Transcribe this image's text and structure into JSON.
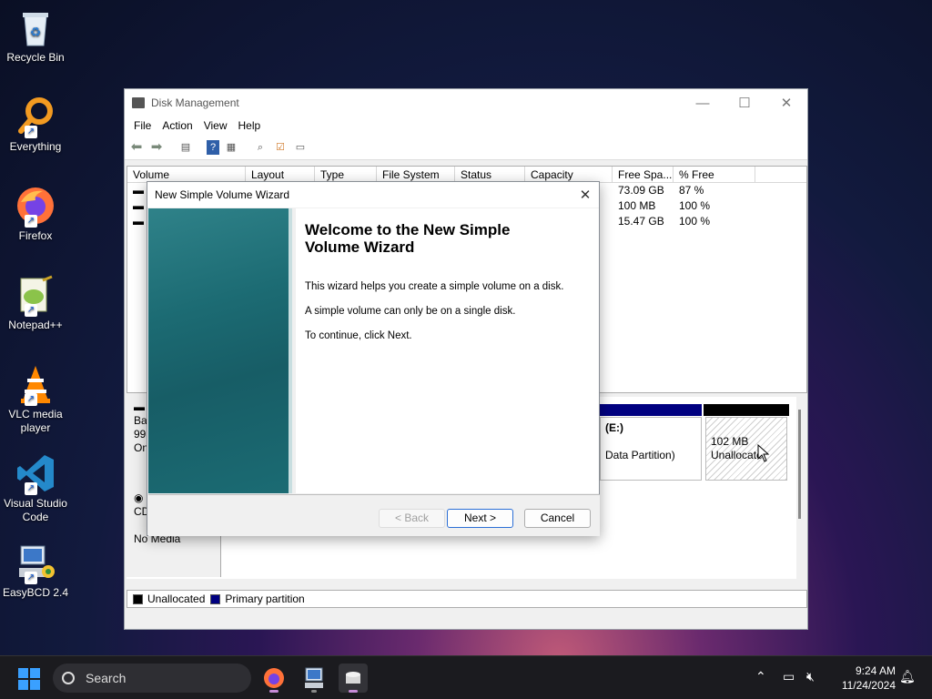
{
  "desktop": {
    "icons": [
      {
        "label": "Recycle Bin",
        "icon": "recycle-bin-icon"
      },
      {
        "label": "Everything",
        "icon": "everything-search-icon"
      },
      {
        "label": "Firefox",
        "icon": "firefox-icon"
      },
      {
        "label": "Notepad++",
        "icon": "notepad-plus-plus-icon"
      },
      {
        "label": "VLC media player",
        "icon": "vlc-icon"
      },
      {
        "label": "Visual Studio Code",
        "icon": "vscode-icon"
      },
      {
        "label": "EasyBCD 2.4",
        "icon": "easybcd-icon"
      }
    ]
  },
  "window": {
    "title": "Disk Management",
    "menu": [
      "File",
      "Action",
      "View",
      "Help"
    ],
    "columns": [
      "Volume",
      "Layout",
      "Type",
      "File System",
      "Status",
      "Capacity",
      "Free Spa...",
      "% Free"
    ],
    "rows": [
      {
        "free": "73.09 GB",
        "pct": "87 %"
      },
      {
        "free": "100 MB",
        "pct": "100 %"
      },
      {
        "free": "15.47 GB",
        "pct": "100 %"
      }
    ],
    "disks": {
      "disk0_label_partial": [
        "Bas",
        "99.",
        "On"
      ],
      "partition_e_title": "(E:)",
      "partition_e_sub": "Data Partition)",
      "unallocated_size": "102 MB",
      "unallocated_label": "Unallocate",
      "cdrom_label": "CD",
      "cdrom_media": "No Media"
    },
    "legend": [
      {
        "label": "Unallocated",
        "color": "#000000"
      },
      {
        "label": "Primary partition",
        "color": "#000080"
      }
    ]
  },
  "wizard": {
    "title": "New Simple Volume Wizard",
    "heading": "Welcome to the New Simple Volume Wizard",
    "p1": "This wizard helps you create a simple volume on a disk.",
    "p2": "A simple volume can only be on a single disk.",
    "p3": "To continue, click Next.",
    "back": "< Back",
    "next": "Next >",
    "cancel": "Cancel"
  },
  "taskbar": {
    "search_placeholder": "Search",
    "time": "9:24 AM",
    "date": "11/24/2024"
  }
}
